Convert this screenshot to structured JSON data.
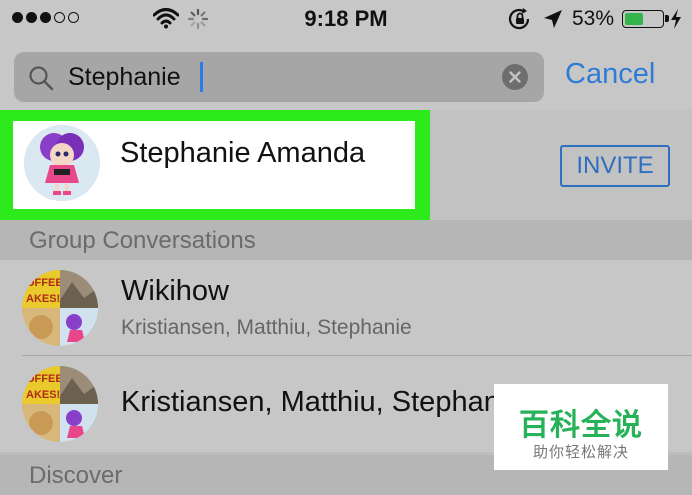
{
  "status_bar": {
    "time": "9:18 PM",
    "battery_percent": "53%",
    "battery_level": 0.53,
    "signal_bars_filled": 3,
    "signal_bars_total": 5,
    "battery_color": "#34b34a"
  },
  "search": {
    "query": "Stephanie",
    "cancel_label": "Cancel",
    "accent_color": "#2f7bd6"
  },
  "contact": {
    "name": "Stephanie Amanda",
    "invite_label": "INVITE",
    "highlight_color": "#2dea1a"
  },
  "sections": {
    "groups_header": "Group Conversations",
    "discover_header": "Discover"
  },
  "groups": [
    {
      "name": "Wikihow",
      "members": "Kristiansen, Matthiu, Stephanie"
    },
    {
      "name": "Kristiansen, Matthiu, Stephanie",
      "members": ""
    }
  ],
  "watermark": {
    "title": "百科全说",
    "subtitle": "助你轻松解决"
  },
  "icons": {
    "wifi": "wifi-icon",
    "spinner": "activity-spinner-icon",
    "rotation_lock": "rotation-lock-icon",
    "location": "location-arrow-icon",
    "charging": "charging-bolt-icon",
    "search": "search-icon",
    "clear": "clear-x-icon"
  }
}
